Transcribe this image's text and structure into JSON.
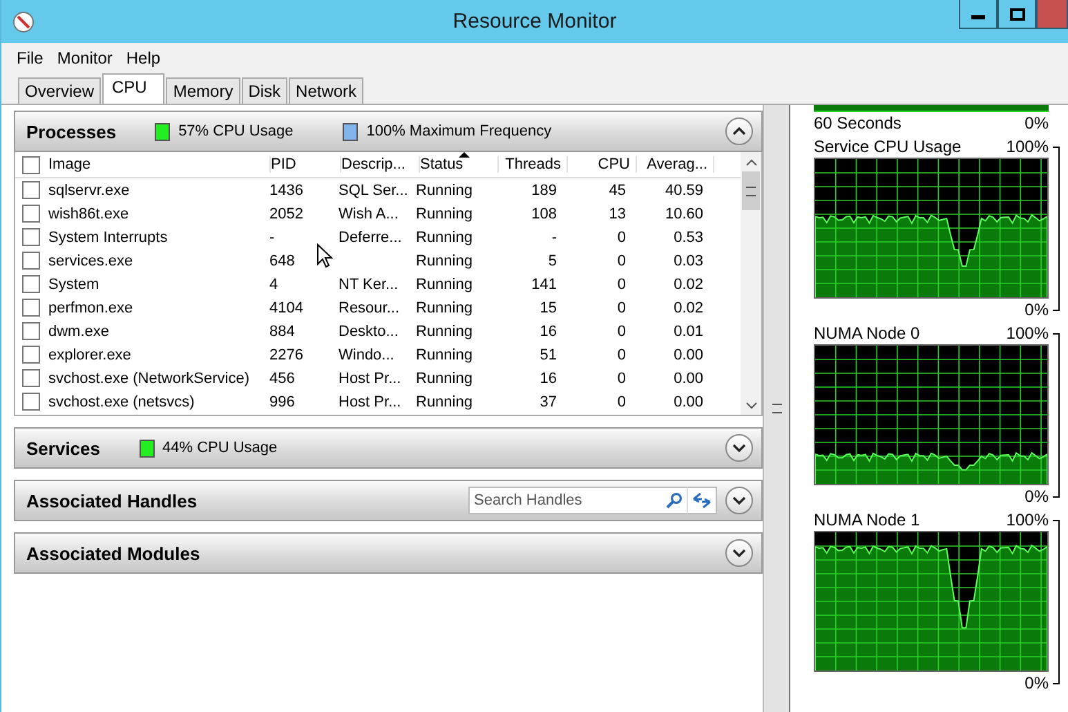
{
  "window": {
    "title": "Resource Monitor"
  },
  "menu": [
    "File",
    "Monitor",
    "Help"
  ],
  "tabs": [
    {
      "label": "Overview",
      "selected": false
    },
    {
      "label": "CPU",
      "selected": true
    },
    {
      "label": "Memory",
      "selected": false
    },
    {
      "label": "Disk",
      "selected": false
    },
    {
      "label": "Network",
      "selected": false
    }
  ],
  "processes": {
    "title": "Processes",
    "expanded": true,
    "select_all_checked": false,
    "cpu_usage": "57% CPU Usage",
    "frequency": "100% Maximum Frequency",
    "columns": [
      {
        "label": "Image",
        "sorted": false
      },
      {
        "label": "PID",
        "sorted": false
      },
      {
        "label": "Descrip...",
        "sorted": false
      },
      {
        "label": "Status",
        "sorted": true
      },
      {
        "label": "Threads",
        "sorted": false
      },
      {
        "label": "CPU",
        "sorted": false
      },
      {
        "label": "Averag...",
        "sorted": false
      }
    ],
    "rows": [
      {
        "checked": false,
        "cells": [
          "sqlservr.exe",
          "1436",
          "SQL Ser...",
          "Running",
          "189",
          "45",
          "40.59"
        ]
      },
      {
        "checked": false,
        "cells": [
          "wish86t.exe",
          "2052",
          "Wish A...",
          "Running",
          "108",
          "13",
          "10.60"
        ]
      },
      {
        "checked": false,
        "cells": [
          "System Interrupts",
          "-",
          "Deferre...",
          "Running",
          "-",
          "0",
          "0.53"
        ]
      },
      {
        "checked": false,
        "cells": [
          "services.exe",
          "648",
          "",
          "Running",
          "5",
          "0",
          "0.03"
        ]
      },
      {
        "checked": false,
        "cells": [
          "System",
          "4",
          "NT Ker...",
          "Running",
          "141",
          "0",
          "0.02"
        ]
      },
      {
        "checked": false,
        "cells": [
          "perfmon.exe",
          "4104",
          "Resour...",
          "Running",
          "15",
          "0",
          "0.02"
        ]
      },
      {
        "checked": false,
        "cells": [
          "dwm.exe",
          "884",
          "Deskto...",
          "Running",
          "16",
          "0",
          "0.01"
        ]
      },
      {
        "checked": false,
        "cells": [
          "explorer.exe",
          "2276",
          "Windo...",
          "Running",
          "51",
          "0",
          "0.00"
        ]
      },
      {
        "checked": false,
        "cells": [
          "svchost.exe (NetworkService)",
          "456",
          "Host Pr...",
          "Running",
          "16",
          "0",
          "0.00"
        ]
      },
      {
        "checked": false,
        "cells": [
          "svchost.exe (netsvcs)",
          "996",
          "Host Pr...",
          "Running",
          "37",
          "0",
          "0.00"
        ]
      }
    ]
  },
  "services": {
    "title": "Services",
    "expanded": false,
    "cpu_usage": "44% CPU Usage"
  },
  "handles": {
    "title": "Associated Handles",
    "expanded": false,
    "search": {
      "placeholder": "Search Handles"
    }
  },
  "modules": {
    "title": "Associated Modules",
    "expanded": false
  },
  "graphs_top": {
    "label": "60 Seconds",
    "min": "0%"
  },
  "graphs": [
    {
      "title": "Service CPU Usage",
      "max": "100%",
      "min": "0%"
    },
    {
      "title": "NUMA Node 0",
      "max": "100%",
      "min": "0%"
    },
    {
      "title": "NUMA Node 1",
      "max": "100%",
      "min": "0%"
    }
  ]
}
